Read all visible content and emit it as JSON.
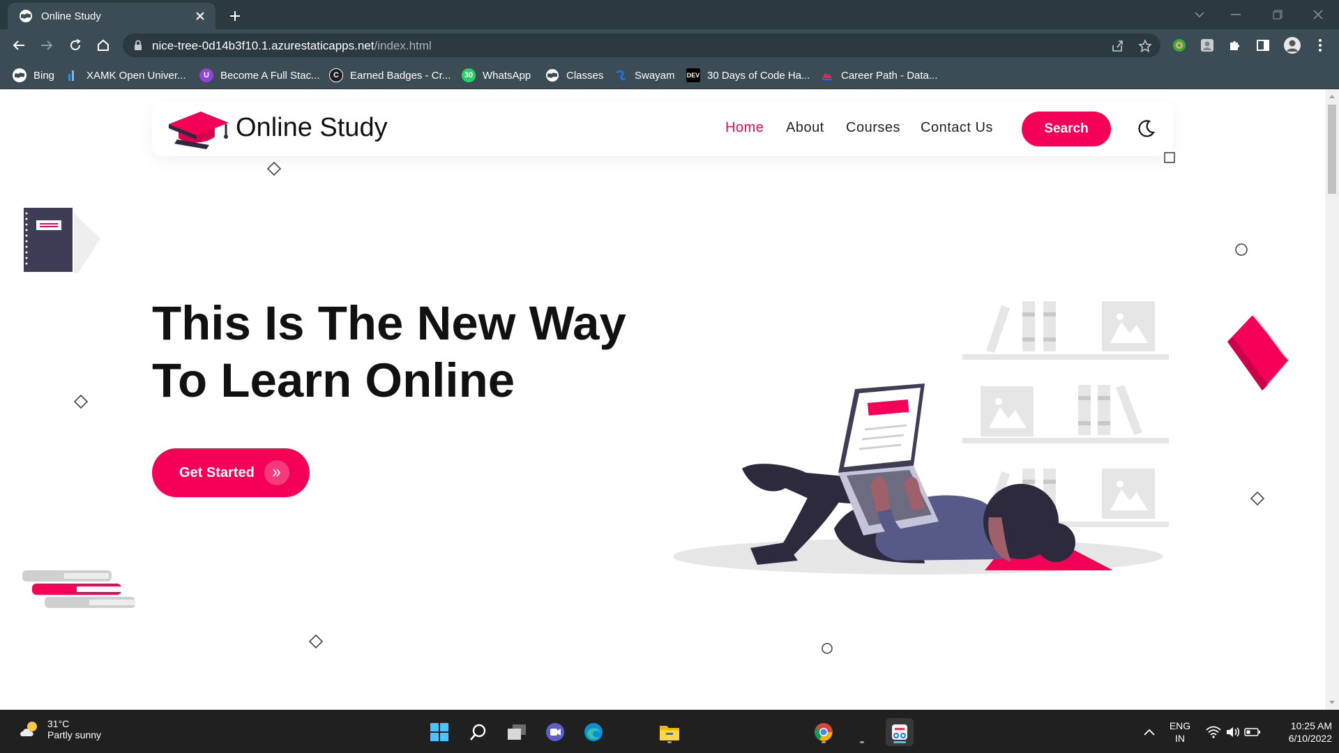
{
  "browser": {
    "tab_title": "Online Study",
    "url_host": "nice-tree-0d14b3f10.1.azurestaticapps.net",
    "url_path": "/index.html",
    "bookmarks": [
      {
        "label": "Bing",
        "icon": "globe-icon"
      },
      {
        "label": "XAMK Open Univer...",
        "icon": "xamk-icon"
      },
      {
        "label": "Become A Full Stac...",
        "icon": "udemy-icon"
      },
      {
        "label": "Earned Badges - Cr...",
        "icon": "credly-icon"
      },
      {
        "label": "WhatsApp",
        "icon": "whatsapp-icon"
      },
      {
        "label": "Classes",
        "icon": "globe-icon"
      },
      {
        "label": "Swayam",
        "icon": "swayam-icon"
      },
      {
        "label": "30 Days of Code Ha...",
        "icon": "dev-icon"
      },
      {
        "label": "Career Path - Data...",
        "icon": "career-icon"
      }
    ]
  },
  "page": {
    "brand": "Online Study",
    "nav": [
      {
        "label": "Home",
        "active": true
      },
      {
        "label": "About",
        "active": false
      },
      {
        "label": "Courses",
        "active": false
      },
      {
        "label": "Contact Us",
        "active": false
      }
    ],
    "search_label": "Search",
    "hero": {
      "title_line1": "This Is The New Way",
      "title_line2": "To Learn Online",
      "cta_label": "Get Started"
    },
    "accent_color": "#f50057"
  },
  "taskbar": {
    "weather_temp": "31°C",
    "weather_cond": "Partly sunny",
    "lang_line1": "ENG",
    "lang_line2": "IN",
    "time": "10:25 AM",
    "date": "6/10/2022"
  }
}
